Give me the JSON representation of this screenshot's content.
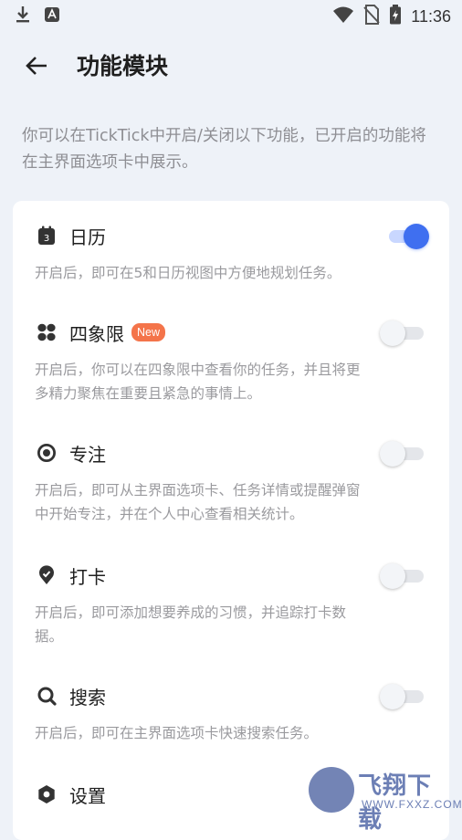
{
  "status_bar": {
    "time": "11:36"
  },
  "app_bar": {
    "title": "功能模块"
  },
  "description": "你可以在TickTick中开启/关闭以下功能，已开启的功能将在主界面选项卡中展示。",
  "features": [
    {
      "label": "日历",
      "desc": "开启后，即可在5和日历视图中方便地规划任务。",
      "enabled": true,
      "icon": "calendar-icon"
    },
    {
      "label": "四象限",
      "badge": "New",
      "desc": "开启后，你可以在四象限中查看你的任务，并且将更多精力聚焦在重要且紧急的事情上。",
      "enabled": false,
      "icon": "matrix-icon"
    },
    {
      "label": "专注",
      "desc": "开启后，即可从主界面选项卡、任务详情或提醒弹窗中开始专注，并在个人中心查看相关统计。",
      "enabled": false,
      "icon": "focus-icon"
    },
    {
      "label": "打卡",
      "desc": "开启后，即可添加想要养成的习惯，并追踪打卡数据。",
      "enabled": false,
      "icon": "habit-pin-icon"
    },
    {
      "label": "搜索",
      "desc": "开启后，即可在主界面选项卡快速搜索任务。",
      "enabled": false,
      "icon": "search-icon"
    },
    {
      "label": "设置",
      "icon": "settings-icon"
    }
  ],
  "watermark": {
    "text": "飞翔下载",
    "url": "WWW.FXXZ.COM"
  },
  "colors": {
    "accent": "#3f6ff0",
    "background": "#eef2f8",
    "badge": "#f4744a"
  }
}
